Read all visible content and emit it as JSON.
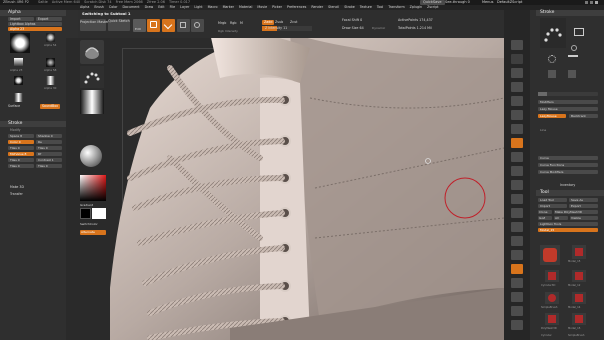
{
  "app": {
    "title": "ZBrush 4R6 P2",
    "menu_left": [
      "Saltle",
      "Active Mem 640",
      "Scratch Disk 74",
      "Free Mem 2066",
      "Zfree 2.06",
      "Timer 0.017"
    ],
    "menu_right_label": "QuickSave",
    "see_through_label": "See-through 0",
    "menus_label": "Menus",
    "default_zscript": "DefaultZScript"
  },
  "menubar": [
    "Alpha",
    "Brush",
    "Color",
    "Document",
    "Draw",
    "Edit",
    "File",
    "Layer",
    "Light",
    "Macro",
    "Marker",
    "Material",
    "Movie",
    "Picker",
    "Preferences",
    "Render",
    "Stencil",
    "Stroke",
    "Texture",
    "Tool",
    "Transform",
    "Zplugin",
    "Zscript"
  ],
  "switching_label": "Switching to Subtool 1",
  "top_tools": {
    "projection_master": "Projection Master",
    "quick_sketch": "Quick Sketch",
    "edit": "Edit",
    "draw": "Draw",
    "move": "Move",
    "scale": "Scale",
    "rotate": "Rotate",
    "mrgb": "Mrgb",
    "rgb": "Rgb",
    "m": "M",
    "rgb_intensity": "Rgb Intensity",
    "zadd": "Zadd",
    "zsub": "Zsub",
    "zcut": "Zcut",
    "z_intensity": "Z Intensity 11",
    "focal_shift": "Focal Shift 0",
    "draw_size": "Draw Size 64",
    "dynamic": "Dynamic",
    "active_points": "ActivePoints 174,437",
    "total_points": "TotalPoints 1.214 Mil"
  },
  "left_panel": {
    "header": "Alpha",
    "import": "Import",
    "export": "Export",
    "lightbox_alphas": "Lightbox Alphas",
    "alpha_value": "Alpha 23",
    "alpha_labels": [
      "Alpha 23",
      "Alpha 54",
      "Alpha 58",
      "Alpha 30"
    ],
    "surface": "Surface",
    "sound_box": "SoundBox",
    "stroke_header": "Stroke",
    "modify": "Modify",
    "stroke_rows": [
      [
        "Space 8",
        "Shadow 0"
      ],
      [
        "Color 0",
        "Re"
      ],
      [
        "Tiles 0",
        "Tiles 0"
      ],
      [
        "MidValue 8",
        "Rf"
      ],
      [
        "Tiles 0",
        "Contrast 1"
      ],
      [
        "Tiles 0",
        "Tiles 0"
      ]
    ],
    "gradient": "Gradient",
    "switch_color": "SwitchColor",
    "alternate": "Alternate",
    "make3d": "Make 3D",
    "transfer": "Transfer"
  },
  "right_panel": {
    "header": "Stroke",
    "modifiers": "Modifiers",
    "lazy_mouse": "Lazy Mouse",
    "lazy_mouse_value": "LazyMouse",
    "backtrack": "Backtrack",
    "line": "Line",
    "curve": "Curve",
    "curve_functions": "Curve Functions",
    "curve_modifiers": "Curve Modifiers",
    "inventory": "Inventory",
    "tool_header": "Tool",
    "load_tool": "Load Tool",
    "save_as": "Save As",
    "import": "Import",
    "export": "Export",
    "clone": "Clone",
    "make_polymesh": "Make PolyMesh3D",
    "goz": "GoZ",
    "all": "All",
    "visible": "Visible",
    "lightbox_tools": "Lightbox Tools",
    "tool_value": "Model_15",
    "tool_thumbs": [
      "Model_15",
      "Cylinder3D",
      "Model_12",
      "SimpleBrush",
      "Model_14",
      "PolyMesh3D",
      "Model_15",
      "Cylinder",
      "SimpleBrush"
    ]
  },
  "right_icons": [
    "BPR",
    "SPix",
    "Scroll",
    "Zoom",
    "Actual",
    "AAHalf",
    "Persp",
    "Floor",
    "Local",
    "LSym",
    "Xyz",
    "Frame",
    "Move",
    "Scale",
    "Rotate",
    "Line Fill",
    "PolyF",
    "Transp",
    "Dynamic",
    "Solo",
    "Xpose"
  ],
  "colors": {
    "accent": "#d8741c",
    "panel": "#303030",
    "canvas": "#2b2b2b",
    "cursor_ring": "#c0202a"
  }
}
